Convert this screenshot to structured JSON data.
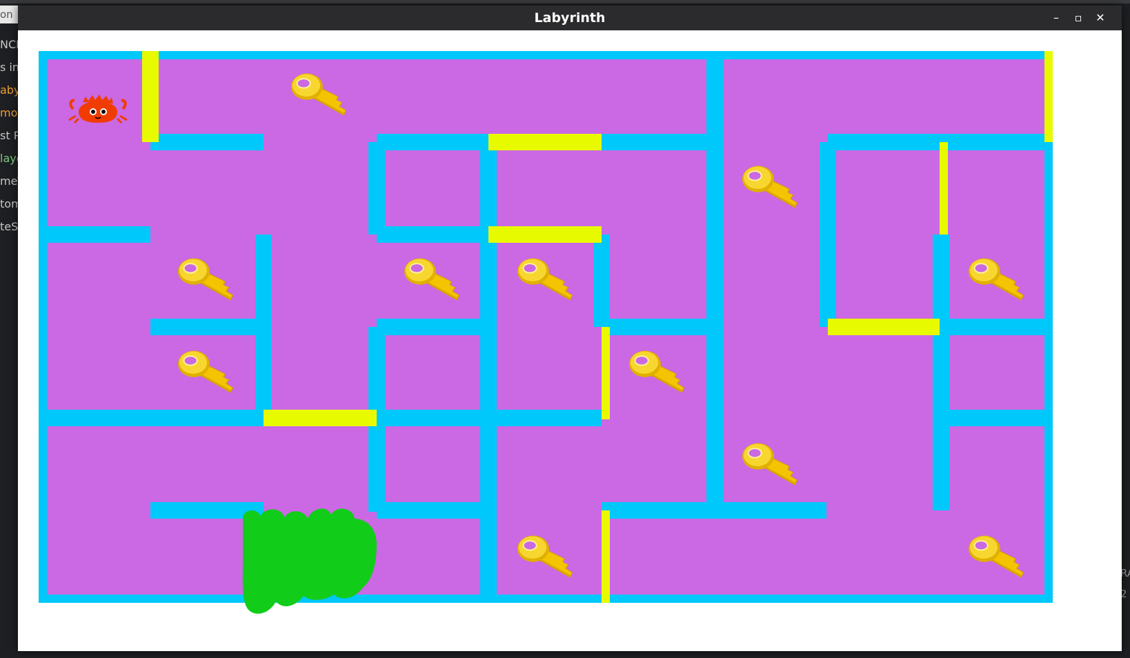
{
  "window": {
    "title": "Labyrinth",
    "minimize_glyph": "–",
    "maximize_glyph": "▫",
    "close_glyph": "✕"
  },
  "background_editor": {
    "search_fragment": "on",
    "lines": [
      {
        "text": "NCE",
        "color": "#c8c8c8"
      },
      {
        "text": "s in",
        "color": "#c8c8c8"
      },
      {
        "text": "abyr",
        "color": "#f0a030"
      },
      {
        "text": "mod",
        "color": "#f0a030"
      },
      {
        "text": "st P",
        "color": "#c8c8c8"
      },
      {
        "text": "laye",
        "color": "#7fc97f"
      },
      {
        "text": "meT",
        "color": "#c8c8c8"
      },
      {
        "text": "tom",
        "color": "#c8c8c8"
      },
      {
        "text": "teS",
        "color": "#c8c8c8"
      }
    ],
    "right_fragments": [
      "RA",
      "2"
    ]
  },
  "game": {
    "colors": {
      "floor": "#cb68e4",
      "wall": "#00c8fa",
      "door": "#e8fa00",
      "exit": "#12cc1a",
      "key": "#f2c400",
      "key_dark": "#c89200",
      "player": "#f03c00"
    },
    "player_icon": "crab-icon",
    "key_icon": "key-icon",
    "exit_icon": "exit-blob"
  }
}
